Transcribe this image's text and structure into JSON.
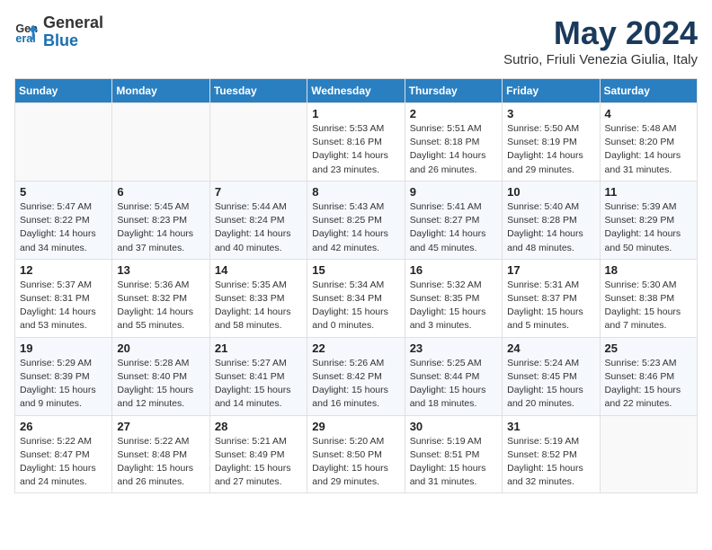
{
  "logo": {
    "text_general": "General",
    "text_blue": "Blue"
  },
  "header": {
    "month": "May 2024",
    "location": "Sutrio, Friuli Venezia Giulia, Italy"
  },
  "weekdays": [
    "Sunday",
    "Monday",
    "Tuesday",
    "Wednesday",
    "Thursday",
    "Friday",
    "Saturday"
  ],
  "weeks": [
    [
      {
        "day": "",
        "info": ""
      },
      {
        "day": "",
        "info": ""
      },
      {
        "day": "",
        "info": ""
      },
      {
        "day": "1",
        "info": "Sunrise: 5:53 AM\nSunset: 8:16 PM\nDaylight: 14 hours\nand 23 minutes."
      },
      {
        "day": "2",
        "info": "Sunrise: 5:51 AM\nSunset: 8:18 PM\nDaylight: 14 hours\nand 26 minutes."
      },
      {
        "day": "3",
        "info": "Sunrise: 5:50 AM\nSunset: 8:19 PM\nDaylight: 14 hours\nand 29 minutes."
      },
      {
        "day": "4",
        "info": "Sunrise: 5:48 AM\nSunset: 8:20 PM\nDaylight: 14 hours\nand 31 minutes."
      }
    ],
    [
      {
        "day": "5",
        "info": "Sunrise: 5:47 AM\nSunset: 8:22 PM\nDaylight: 14 hours\nand 34 minutes."
      },
      {
        "day": "6",
        "info": "Sunrise: 5:45 AM\nSunset: 8:23 PM\nDaylight: 14 hours\nand 37 minutes."
      },
      {
        "day": "7",
        "info": "Sunrise: 5:44 AM\nSunset: 8:24 PM\nDaylight: 14 hours\nand 40 minutes."
      },
      {
        "day": "8",
        "info": "Sunrise: 5:43 AM\nSunset: 8:25 PM\nDaylight: 14 hours\nand 42 minutes."
      },
      {
        "day": "9",
        "info": "Sunrise: 5:41 AM\nSunset: 8:27 PM\nDaylight: 14 hours\nand 45 minutes."
      },
      {
        "day": "10",
        "info": "Sunrise: 5:40 AM\nSunset: 8:28 PM\nDaylight: 14 hours\nand 48 minutes."
      },
      {
        "day": "11",
        "info": "Sunrise: 5:39 AM\nSunset: 8:29 PM\nDaylight: 14 hours\nand 50 minutes."
      }
    ],
    [
      {
        "day": "12",
        "info": "Sunrise: 5:37 AM\nSunset: 8:31 PM\nDaylight: 14 hours\nand 53 minutes."
      },
      {
        "day": "13",
        "info": "Sunrise: 5:36 AM\nSunset: 8:32 PM\nDaylight: 14 hours\nand 55 minutes."
      },
      {
        "day": "14",
        "info": "Sunrise: 5:35 AM\nSunset: 8:33 PM\nDaylight: 14 hours\nand 58 minutes."
      },
      {
        "day": "15",
        "info": "Sunrise: 5:34 AM\nSunset: 8:34 PM\nDaylight: 15 hours\nand 0 minutes."
      },
      {
        "day": "16",
        "info": "Sunrise: 5:32 AM\nSunset: 8:35 PM\nDaylight: 15 hours\nand 3 minutes."
      },
      {
        "day": "17",
        "info": "Sunrise: 5:31 AM\nSunset: 8:37 PM\nDaylight: 15 hours\nand 5 minutes."
      },
      {
        "day": "18",
        "info": "Sunrise: 5:30 AM\nSunset: 8:38 PM\nDaylight: 15 hours\nand 7 minutes."
      }
    ],
    [
      {
        "day": "19",
        "info": "Sunrise: 5:29 AM\nSunset: 8:39 PM\nDaylight: 15 hours\nand 9 minutes."
      },
      {
        "day": "20",
        "info": "Sunrise: 5:28 AM\nSunset: 8:40 PM\nDaylight: 15 hours\nand 12 minutes."
      },
      {
        "day": "21",
        "info": "Sunrise: 5:27 AM\nSunset: 8:41 PM\nDaylight: 15 hours\nand 14 minutes."
      },
      {
        "day": "22",
        "info": "Sunrise: 5:26 AM\nSunset: 8:42 PM\nDaylight: 15 hours\nand 16 minutes."
      },
      {
        "day": "23",
        "info": "Sunrise: 5:25 AM\nSunset: 8:44 PM\nDaylight: 15 hours\nand 18 minutes."
      },
      {
        "day": "24",
        "info": "Sunrise: 5:24 AM\nSunset: 8:45 PM\nDaylight: 15 hours\nand 20 minutes."
      },
      {
        "day": "25",
        "info": "Sunrise: 5:23 AM\nSunset: 8:46 PM\nDaylight: 15 hours\nand 22 minutes."
      }
    ],
    [
      {
        "day": "26",
        "info": "Sunrise: 5:22 AM\nSunset: 8:47 PM\nDaylight: 15 hours\nand 24 minutes."
      },
      {
        "day": "27",
        "info": "Sunrise: 5:22 AM\nSunset: 8:48 PM\nDaylight: 15 hours\nand 26 minutes."
      },
      {
        "day": "28",
        "info": "Sunrise: 5:21 AM\nSunset: 8:49 PM\nDaylight: 15 hours\nand 27 minutes."
      },
      {
        "day": "29",
        "info": "Sunrise: 5:20 AM\nSunset: 8:50 PM\nDaylight: 15 hours\nand 29 minutes."
      },
      {
        "day": "30",
        "info": "Sunrise: 5:19 AM\nSunset: 8:51 PM\nDaylight: 15 hours\nand 31 minutes."
      },
      {
        "day": "31",
        "info": "Sunrise: 5:19 AM\nSunset: 8:52 PM\nDaylight: 15 hours\nand 32 minutes."
      },
      {
        "day": "",
        "info": ""
      }
    ]
  ]
}
